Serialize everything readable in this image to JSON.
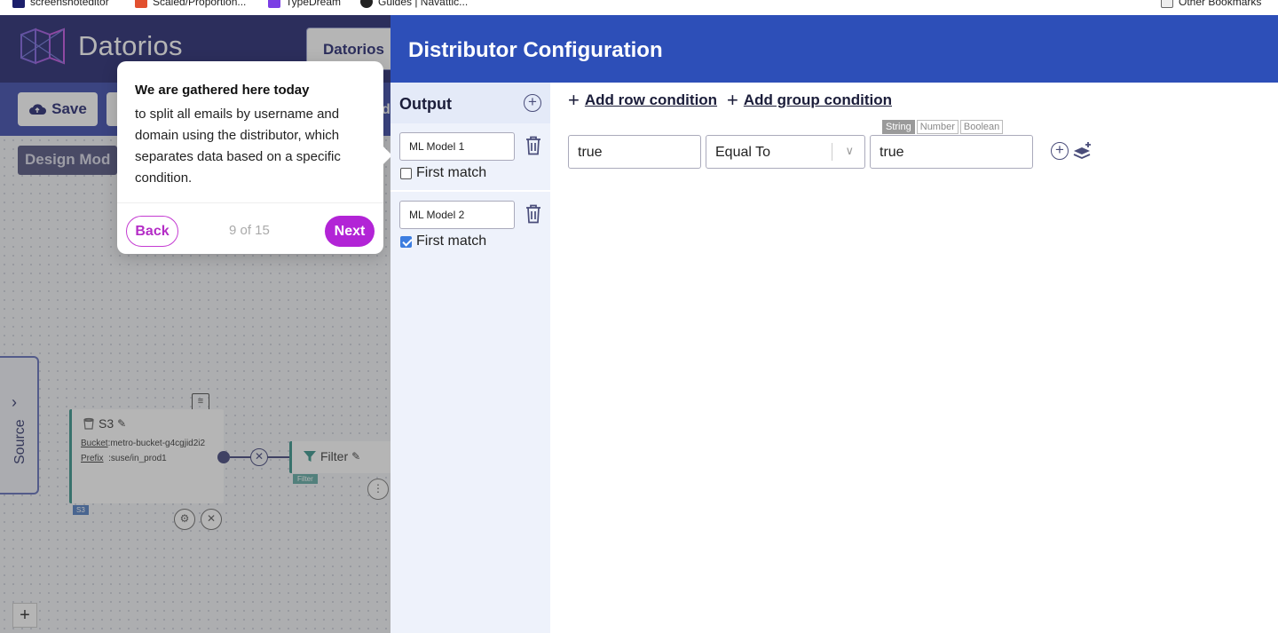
{
  "bookmarks": {
    "items": [
      {
        "label": "screenshoteditor",
        "color": "#1c1f6b"
      },
      {
        "label": "Scaled/Proportion...",
        "color": "#e2502f"
      },
      {
        "label": "TypeDream",
        "color": "#7b3fe4"
      },
      {
        "label": "Guides | Navattic...",
        "color": "#222222"
      }
    ],
    "other": "Other Bookmarks"
  },
  "app": {
    "brand": "Datorios",
    "pipeline_title": "Datorios",
    "save_label": "Save",
    "toolbar_cut": "di",
    "design_mode": "Design Mod",
    "source_tab": "Source",
    "s3_node": {
      "title": "S3",
      "bucket_key": "Bucket",
      "bucket_value": ":metro-bucket-g4cgjid2i2",
      "prefix_key": "Prefix",
      "prefix_value": ":suse/in_prod1",
      "tag": "S3"
    },
    "filter_node": {
      "title": "Filter",
      "tag": "Filter"
    }
  },
  "tour": {
    "title": "We are gathered here today",
    "body": "to split all emails by username and domain using the distributor, which separates data based on a specific condition.",
    "back_label": "Back",
    "progress": "9 of 15",
    "next_label": "Next",
    "accent": "#b224d6"
  },
  "panel": {
    "title": "Distributor Configuration",
    "header_color": "#2d4fb8",
    "output_title": "Output",
    "outputs": [
      {
        "name": "ML Model 1",
        "first_match_label": "First match",
        "first_match": false
      },
      {
        "name": "ML Model 2",
        "first_match_label": "First match",
        "first_match": true
      }
    ],
    "add_row_label": "Add row condition",
    "add_group_label": "Add group condition",
    "type_tabs": [
      "String",
      "Number",
      "Boolean"
    ],
    "active_type": "String",
    "condition": {
      "left_value": "true",
      "operator": "Equal To",
      "right_value": "true"
    }
  }
}
